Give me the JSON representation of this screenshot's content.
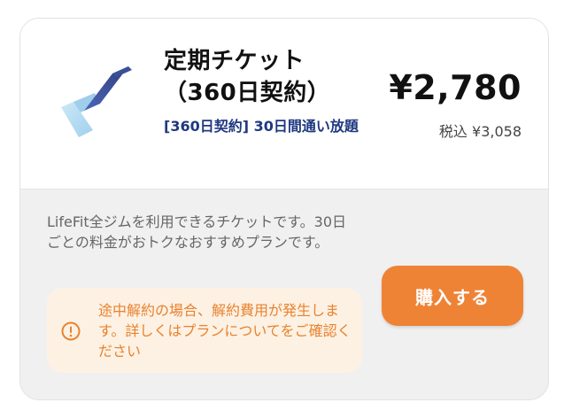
{
  "ticket": {
    "logo_icon": "lifefit-logo-icon",
    "title": "定期チケット（360日契約）",
    "subtitle": "[360日契約]  30日間通い放題",
    "price": "¥2,780",
    "price_tax": "税込 ¥3,058",
    "description": "LifeFit全ジムを利用できるチケットです。30日ごとの料金がおトクなおすすめプランです。",
    "notice": {
      "icon": "exclamation-circle-icon",
      "text": "途中解約の場合、解約費用が発生します。詳しくはプランについてをご確認ください"
    },
    "buy_button_label": "購入する"
  },
  "colors": {
    "accent_orange": "#ee8336",
    "notice_text": "#e8822e",
    "notice_bg": "#fdf1e3",
    "subtitle_navy": "#1f3880"
  }
}
